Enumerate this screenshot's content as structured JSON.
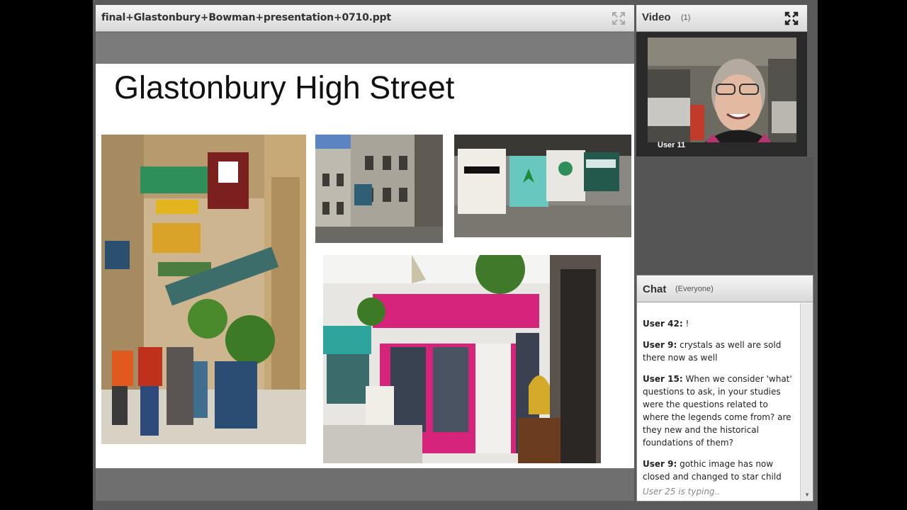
{
  "share": {
    "title": "final+Glastonbury+Bowman+presentation+0710.ppt",
    "slide_title": "Glastonbury High Street"
  },
  "video": {
    "title": "Video",
    "count": "(1)",
    "user": "User 11"
  },
  "chat": {
    "title": "Chat",
    "scope": "(Everyone)",
    "messages": [
      {
        "user": "User 42:",
        "text": " !"
      },
      {
        "user": "User 9:",
        "text": " crystals as well are sold there now as well"
      },
      {
        "user": "User 15:",
        "text": " When we consider 'what' questions to ask, in your studies were the questions related to where the legends come from? are they new and the historical foundations of them?"
      },
      {
        "user": "User 9:",
        "text": " gothic image has now closed and changed to star child"
      }
    ],
    "typing": "User 25 is typing.."
  },
  "colors": {
    "accent_pink": "#d6247a",
    "shop_green": "#2f8f5b"
  }
}
